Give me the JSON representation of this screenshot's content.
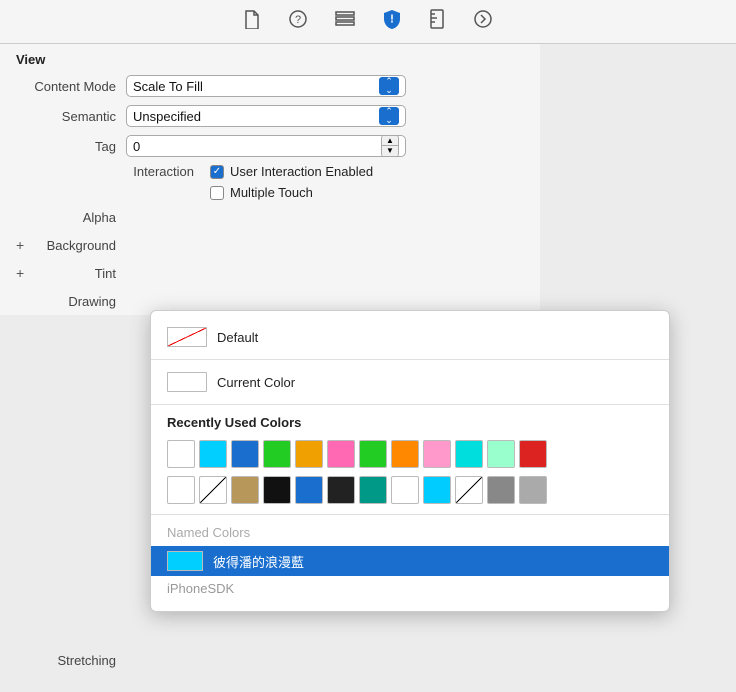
{
  "toolbar": {
    "icons": [
      {
        "name": "file-icon",
        "symbol": "🗋",
        "active": false
      },
      {
        "name": "help-icon",
        "symbol": "?",
        "active": false
      },
      {
        "name": "list-icon",
        "symbol": "☰",
        "active": false
      },
      {
        "name": "shield-icon",
        "symbol": "⬧",
        "active": true
      },
      {
        "name": "ruler-icon",
        "symbol": "📏",
        "active": false
      },
      {
        "name": "arrow-right-icon",
        "symbol": "→",
        "active": false
      }
    ]
  },
  "inspector": {
    "section_view": "View",
    "content_mode_label": "Content Mode",
    "content_mode_value": "Scale To Fill",
    "semantic_label": "Semantic",
    "semantic_value": "Unspecified",
    "tag_label": "Tag",
    "tag_value": "0",
    "interaction_label": "Interaction",
    "user_interaction_label": "User Interaction Enabled",
    "multiple_touch_label": "Multiple Touch",
    "alpha_label": "Alpha",
    "background_label": "Background",
    "tint_label": "Tint",
    "drawing_label": "Drawing",
    "stretching_label": "Stretching"
  },
  "dropdown": {
    "default_label": "Default",
    "current_color_label": "Current Color",
    "recently_used_label": "Recently Used Colors",
    "named_colors_label": "Named Colors",
    "named_color_selected": "彼得潘的浪漫藍",
    "iphoneSDK_label": "iPhoneSDK",
    "colors_row1": [
      {
        "bg": "#ffffff"
      },
      {
        "bg": "#00cfff"
      },
      {
        "bg": "#1a6fce"
      },
      {
        "bg": "#22cc22"
      },
      {
        "bg": "#f0a000"
      },
      {
        "bg": "#ff69b4"
      },
      {
        "bg": "#22cc22"
      },
      {
        "bg": "#ff8800"
      },
      {
        "bg": "#ff99cc"
      },
      {
        "bg": "#00dddd"
      },
      {
        "bg": "#99ffcc"
      },
      {
        "bg": "#dd2222"
      }
    ],
    "colors_row2": [
      {
        "bg": "#ffffff"
      },
      {
        "bg": "diagonal"
      },
      {
        "bg": "#b8975a"
      },
      {
        "bg": "#111111"
      },
      {
        "bg": "#1a6fce"
      },
      {
        "bg": "#222222"
      },
      {
        "bg": "#009988"
      },
      {
        "bg": "#ffffff"
      },
      {
        "bg": "#00ccff"
      },
      {
        "bg": "diagonal2"
      },
      {
        "bg": "#888888"
      },
      {
        "bg": "#aaaaaa"
      }
    ]
  }
}
